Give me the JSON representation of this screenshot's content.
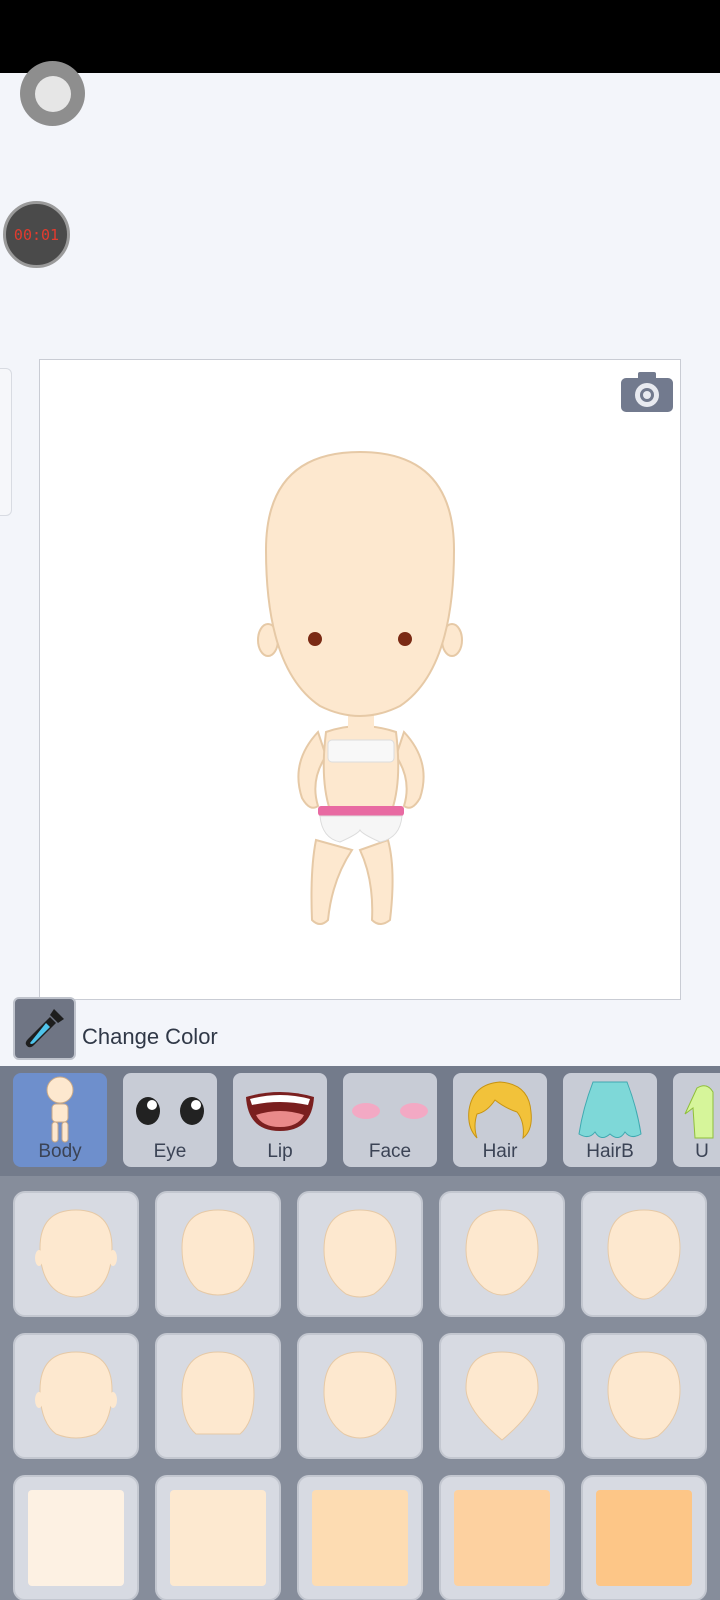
{
  "status_bar": {},
  "recorder": {
    "timer_text": "00:01"
  },
  "canvas": {
    "camera_icon": "camera-icon"
  },
  "change_color": {
    "label": "Change Color",
    "icon": "eyedropper-icon"
  },
  "tabs": [
    {
      "label": "Body",
      "active": true
    },
    {
      "label": "Eye",
      "active": false
    },
    {
      "label": "Lip",
      "active": false
    },
    {
      "label": "Face",
      "active": false
    },
    {
      "label": "Hair",
      "active": false
    },
    {
      "label": "HairB",
      "active": false
    },
    {
      "label": "U",
      "active": false
    }
  ],
  "swatches": [
    "#fdf1e3",
    "#fde9d0",
    "#fddcb2",
    "#fdd1a0",
    "#fdc687"
  ],
  "colors": {
    "skin": "#fde8cf",
    "active_tab": "#6e8fcc",
    "tab_bar": "#737b8b",
    "grid_bg": "#868d9b"
  }
}
